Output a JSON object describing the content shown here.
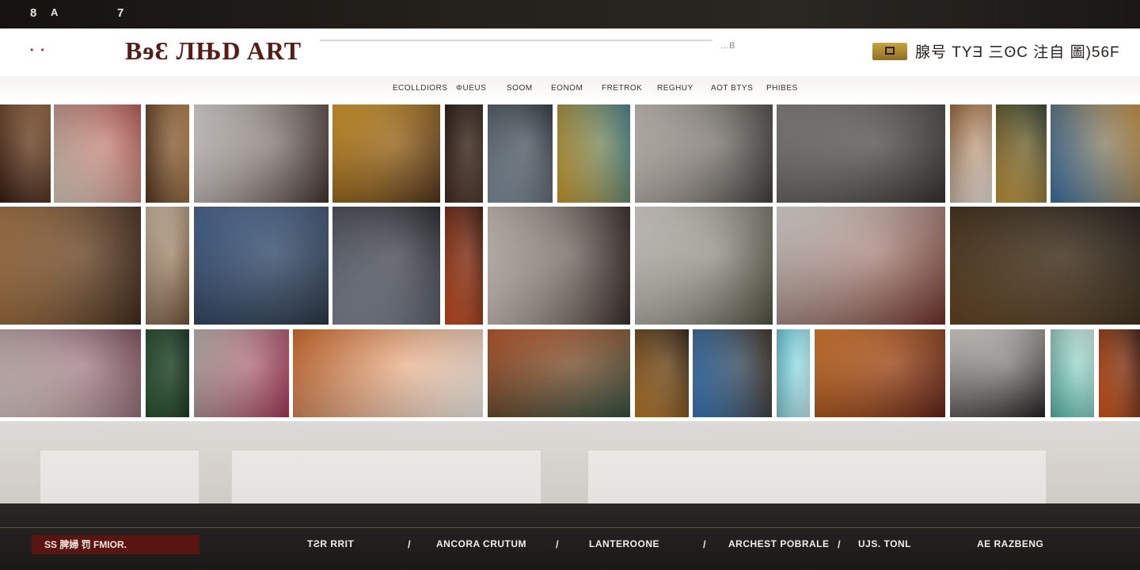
{
  "topbar": {
    "left_num": "8",
    "left_glyph": "A",
    "right_num": "7"
  },
  "header": {
    "logo": "BɘƐ ЛЊD ART",
    "search_mark": "…B",
    "right_text": "腺号 TYƎ 三ʘC 注自 圖)56F"
  },
  "nav": {
    "items": [
      "ECOLLDIORS",
      "ΦUEUS",
      "SOOM",
      "EONOM",
      "FRETROK",
      "REGHUY",
      "AOT BTYS",
      "PHIBES"
    ]
  },
  "gallery": {
    "tiles": [
      {
        "name": "art-tile-r1-1",
        "colors": [
          "#3a1f12",
          "#8a5a34"
        ]
      },
      {
        "name": "art-tile-r1-2",
        "colors": [
          "#e9dccb",
          "#b0504a"
        ]
      },
      {
        "name": "art-tile-r1-3",
        "colors": [
          "#5a3a22",
          "#a97844"
        ]
      },
      {
        "name": "art-tile-r1-4",
        "colors": [
          "#ece8e4",
          "#3a2a26"
        ]
      },
      {
        "name": "art-tile-r1-5",
        "colors": [
          "#e6a427",
          "#4a2a12"
        ]
      },
      {
        "name": "art-tile-r1-6",
        "colors": [
          "#2a1a12",
          "#4a3224"
        ]
      },
      {
        "name": "art-tile-r1-7",
        "colors": [
          "#8a9aa8",
          "#2a3038"
        ]
      },
      {
        "name": "art-tile-r1-8",
        "colors": [
          "#d9a630",
          "#3c7a82"
        ]
      },
      {
        "name": "art-tile-r1-9",
        "colors": [
          "#d6cfc6",
          "#3a3634"
        ]
      },
      {
        "name": "art-tile-r1-10",
        "colors": [
          "#8a8884",
          "#2c2a28"
        ]
      },
      {
        "name": "art-tile-r1-11",
        "colors": [
          "#a06a3a",
          "#e8e0d8"
        ]
      },
      {
        "name": "art-tile-r1-12",
        "colors": [
          "#d4a03a",
          "#2a3a2a"
        ]
      },
      {
        "name": "art-tile-r1-13",
        "colors": [
          "#3c78b0",
          "#c08a3a"
        ]
      },
      {
        "name": "art-tile-r2-1",
        "colors": [
          "#b07a46",
          "#3a2414"
        ]
      },
      {
        "name": "art-tile-r2-2",
        "colors": [
          "#d8c4a8",
          "#6a4a30"
        ]
      },
      {
        "name": "art-tile-r2-3",
        "colors": [
          "#4a6a9a",
          "#23303e"
        ]
      },
      {
        "name": "art-tile-r2-4",
        "colors": [
          "#8a92a2",
          "#1e1e24"
        ]
      },
      {
        "name": "art-tile-r2-5",
        "colors": [
          "#d8501e",
          "#3a1208"
        ]
      },
      {
        "name": "art-tile-r2-6",
        "colors": [
          "#d8cfc4",
          "#2e2420"
        ]
      },
      {
        "name": "art-tile-r2-7",
        "colors": [
          "#ece8e2",
          "#4a4a3a"
        ]
      },
      {
        "name": "art-tile-r2-8",
        "colors": [
          "#efebe6",
          "#6a2a1e"
        ]
      },
      {
        "name": "art-tile-r2-9",
        "colors": [
          "#6a4a24",
          "#1a140e"
        ]
      },
      {
        "name": "art-tile-r3-1",
        "colors": [
          "#e8d8d4",
          "#7a4a58"
        ]
      },
      {
        "name": "art-tile-r3-2",
        "colors": [
          "#2a5a30",
          "#102a18"
        ]
      },
      {
        "name": "art-tile-r3-3",
        "colors": [
          "#c8c0b8",
          "#a03050"
        ]
      },
      {
        "name": "art-tile-r3-4",
        "colors": [
          "#e0702a",
          "#f2f0ec"
        ]
      },
      {
        "name": "art-tile-r3-5",
        "colors": [
          "#c85a28",
          "#2a4a3a"
        ]
      },
      {
        "name": "art-tile-r3-6",
        "colors": [
          "#c8842a",
          "#2a1a0e"
        ]
      },
      {
        "name": "art-tile-r3-7",
        "colors": [
          "#3a80c8",
          "#3a2a1a"
        ]
      },
      {
        "name": "art-tile-r3-8",
        "colors": [
          "#6ad0e0",
          "#bfe8ee"
        ]
      },
      {
        "name": "art-tile-r3-9",
        "colors": [
          "#e8802a",
          "#5a1a0e"
        ]
      },
      {
        "name": "art-tile-r3-10",
        "colors": [
          "#e8e4de",
          "#1a1818"
        ]
      },
      {
        "name": "art-tile-r3-11",
        "colors": [
          "#5ac0b0",
          "#c8e8e0"
        ]
      },
      {
        "name": "art-tile-r3-12",
        "colors": [
          "#e85a18",
          "#3a1a0e"
        ]
      }
    ]
  },
  "bottom": {
    "cta": "SS 脾婦 罚 FMIOR.",
    "items": [
      "TƧR RRIT",
      "ANCORA CRUTUM",
      "LANTEROONE",
      "ARCHEST POBRALE",
      "UJS. TONL",
      "AE RAZBENG"
    ],
    "separator": "/"
  }
}
